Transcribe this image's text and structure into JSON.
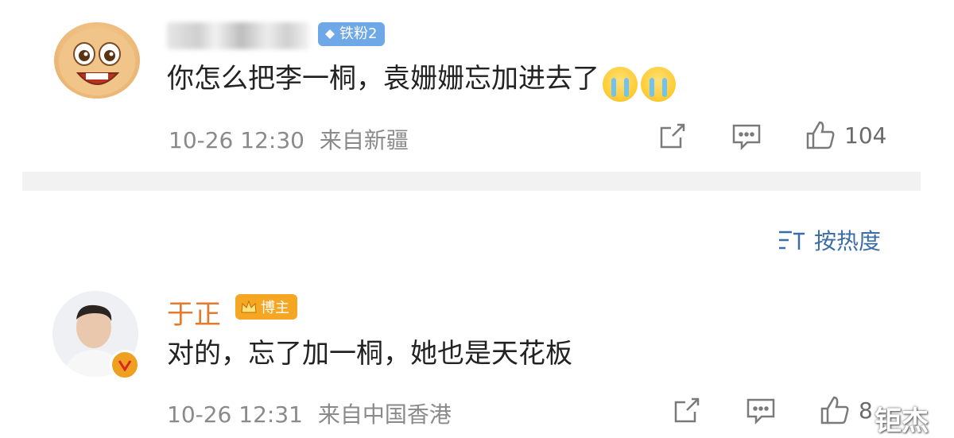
{
  "comment1": {
    "fan_badge": "铁粉2",
    "text": "你怎么把李一桐，袁姗姗忘加进去了",
    "emojis": [
      "crying-face-icon",
      "crying-face-icon"
    ],
    "timestamp": "10-26 12:30",
    "location": "来自新疆",
    "likes": "104"
  },
  "sort": {
    "label": "按热度"
  },
  "comment2": {
    "author": "于正",
    "badge": "博主",
    "text": "对的，忘了加一桐，她也是天花板",
    "timestamp": "10-26 12:31",
    "location": "来自中国香港",
    "likes": "8"
  },
  "watermark": "钜杰",
  "colors": {
    "author": "#e8782a",
    "sort": "#3b6ea8",
    "fan_badge": "#6fa8e6",
    "blogger_badge": "#f5a623",
    "meta": "#8a8a8a"
  }
}
